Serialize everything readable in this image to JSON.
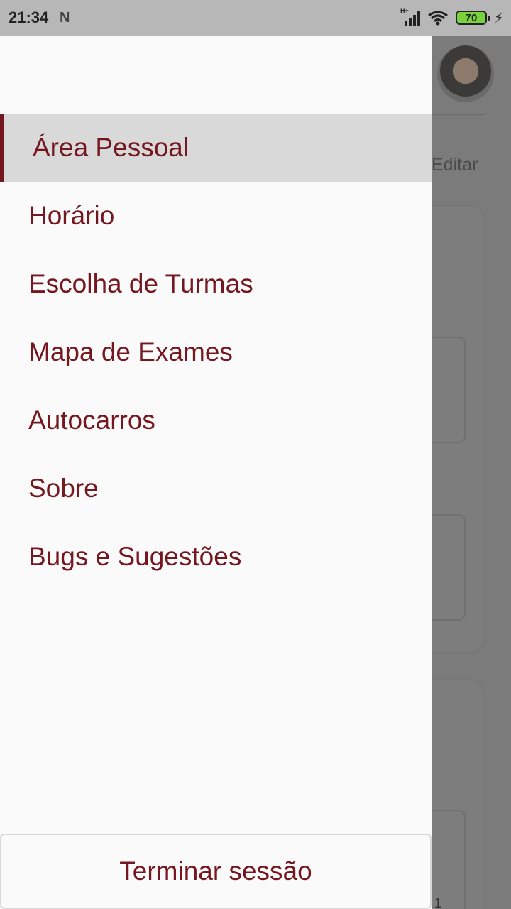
{
  "status_bar": {
    "time": "21:34",
    "notification_icon": "N",
    "network_label": "H+",
    "battery": "70",
    "charging_icon": "bolt"
  },
  "drawer": {
    "items": [
      {
        "label": "Área Pessoal",
        "active": true
      },
      {
        "label": "Horário",
        "active": false
      },
      {
        "label": "Escolha de Turmas",
        "active": false
      },
      {
        "label": "Mapa de Exames",
        "active": false
      },
      {
        "label": "Autocarros",
        "active": false
      },
      {
        "label": "Sobre",
        "active": false
      },
      {
        "label": "Bugs e Sugestões",
        "active": false
      }
    ],
    "logout_label": "Terminar sessão"
  },
  "background": {
    "edit_label": "Editar",
    "footer_number": "1"
  },
  "colors": {
    "accent": "#75171e",
    "drawer_bg": "#fafafa",
    "active_item_bg": "#d9d9d9",
    "statusbar_bg": "#b7b7b7"
  }
}
